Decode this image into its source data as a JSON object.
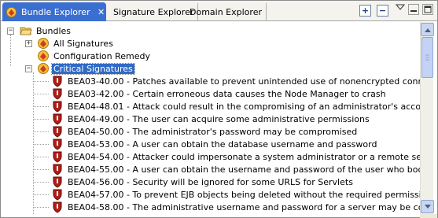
{
  "tabs": {
    "active": "Bundle Explorer",
    "signature": "Signature Explorer",
    "domain": "Domain Explorer"
  },
  "icons": {
    "tab_close": "close-icon",
    "expand_all": "expand-all-icon",
    "collapse_all": "collapse-all-icon",
    "view_menu": "chevron-down-icon",
    "minimize": "minimize-icon",
    "maximize": "maximize-icon"
  },
  "tree": {
    "root": "Bundles",
    "all_signatures": "All Signatures",
    "configuration_remedy": "Configuration Remedy",
    "critical_signatures": "Critical Signatures",
    "signatures": [
      "BEA03-40.00 - Patches available to prevent unintended use of nonencrypted connection",
      "BEA03-42.00 - Certain erroneous data causes the Node Manager to crash",
      "BEA04-48.01 - Attack could result in the compromising of an administrator's account",
      "BEA04-49.00 - The user can acquire some administrative permissions",
      "BEA04-50.00 - The administrator's password may be compromised",
      "BEA04-53.00 - A user can obtain the database username and password",
      "BEA04-54.00 - Attacker could impersonate a system administrator or a remote server",
      "BEA04-55.00 - A user can obtain the username and password of the user who boots server",
      "BEA04-56.00 - Security will be ignored for some URLS for Servlets",
      "BEA04-57.00 - To prevent EJB objects being deleted without the required permission",
      "BEA04-58.00 - The administrative username and password for a server may be compromised"
    ]
  },
  "colors": {
    "tab_active": "#3a6fd1",
    "selection": "#316ac5",
    "shield_red": "#b01e18"
  }
}
